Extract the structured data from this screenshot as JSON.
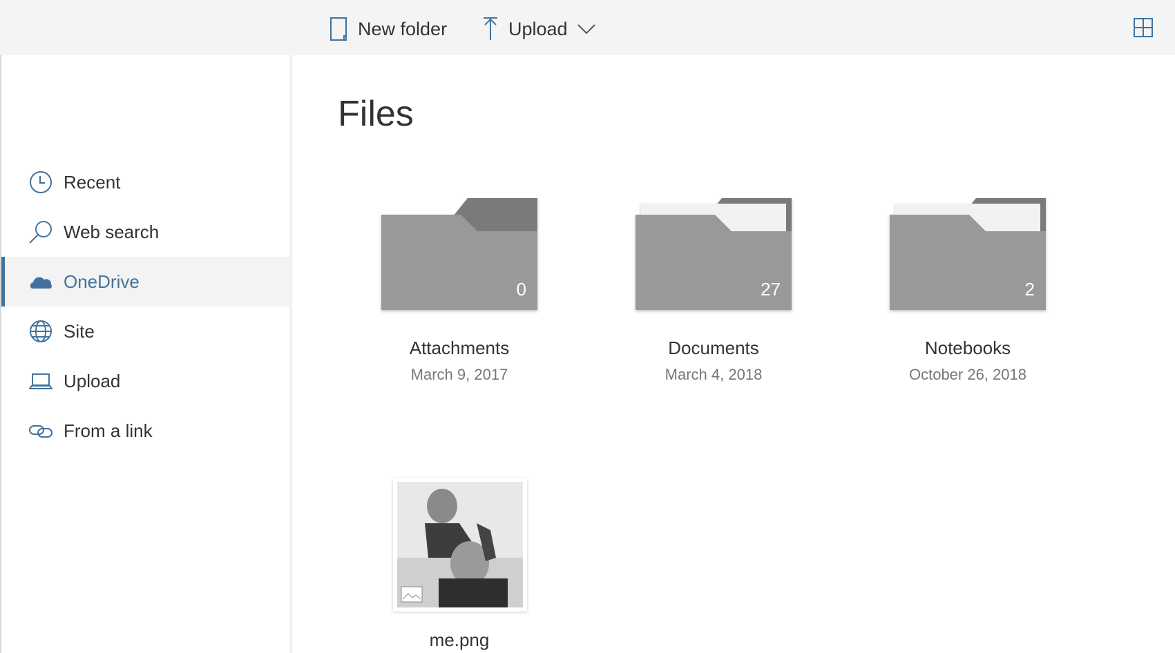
{
  "toolbar": {
    "new_folder": "New folder",
    "upload": "Upload"
  },
  "sidebar": {
    "items": [
      {
        "label": "Recent",
        "icon": "clock-icon"
      },
      {
        "label": "Web search",
        "icon": "search-icon"
      },
      {
        "label": "OneDrive",
        "icon": "cloud-icon",
        "active": true
      },
      {
        "label": "Site",
        "icon": "globe-icon"
      },
      {
        "label": "Upload",
        "icon": "laptop-icon"
      },
      {
        "label": "From a link",
        "icon": "link-icon"
      }
    ]
  },
  "main": {
    "title": "Files",
    "folders": [
      {
        "name": "Attachments",
        "date": "March 9, 2017",
        "count": "0"
      },
      {
        "name": "Documents",
        "date": "March 4, 2018",
        "count": "27"
      },
      {
        "name": "Notebooks",
        "date": "October 26, 2018",
        "count": "2"
      }
    ],
    "files": [
      {
        "name": "me.png"
      }
    ]
  },
  "colors": {
    "accent": "#41729e",
    "topbar": "#f4f4f4",
    "folder": "#999999"
  }
}
